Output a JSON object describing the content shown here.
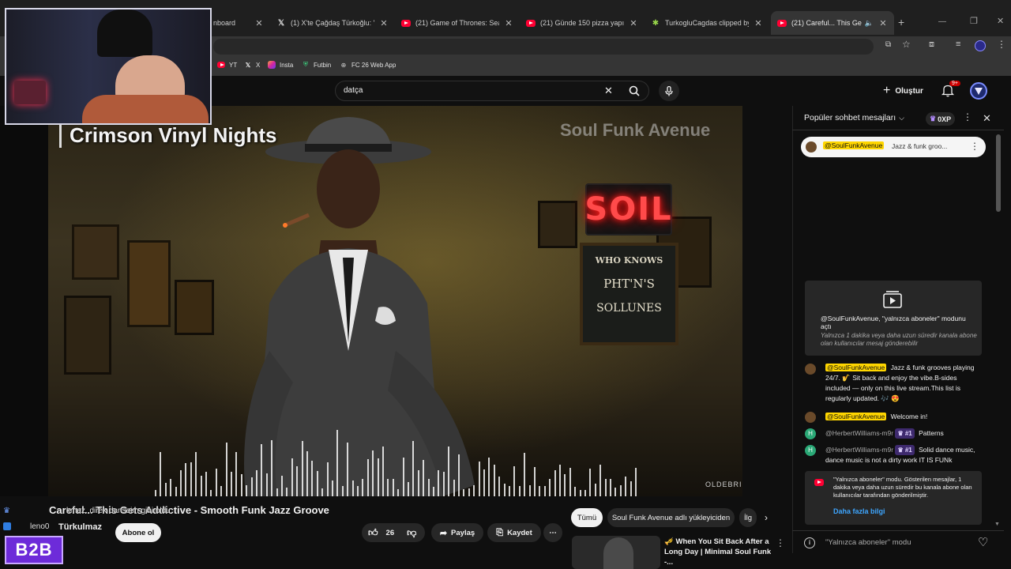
{
  "tabs": [
    {
      "label": "nboard",
      "icon": "dashboard-icon"
    },
    {
      "label": "(1) X'te Çağdaş Türkoğlu: \"Şim",
      "icon": "x-logo-icon"
    },
    {
      "label": "(21) Game of Thrones: Season",
      "icon": "youtube-icon"
    },
    {
      "label": "(21) Günde 150 pizza yapıp dü",
      "icon": "youtube-icon"
    },
    {
      "label": "TurkogluCagdas clipped by Tur",
      "icon": "twitch-clip-icon"
    },
    {
      "label": "(21) Careful... This Gets Add",
      "icon": "youtube-icon"
    }
  ],
  "bookmarks": [
    {
      "label": "YT",
      "icon": "youtube-icon"
    },
    {
      "label": "X",
      "icon": "x-logo-icon"
    },
    {
      "label": "Insta",
      "icon": "instagram-icon"
    },
    {
      "label": "Futbin",
      "icon": "futbin-icon"
    },
    {
      "label": "FC 26 Web App",
      "icon": "globe-icon"
    }
  ],
  "search": {
    "value": "datça"
  },
  "header": {
    "create_label": "Oluştur",
    "notif_count": "9+"
  },
  "video": {
    "overlay_title": "Crimson Vinyl Nights",
    "watermark": "Soul Funk Avenue",
    "neon_sign": "SOIL",
    "board_text": [
      "WHO KNOWS",
      "PHT'N'S",
      "SOLLUNES"
    ],
    "corner_mark": "OLDEBRI"
  },
  "below": {
    "video_title": "Careful... This Gets Addictive - Smooth Funk Jazz Groove",
    "overlay_text": "kmez. direk danseim gibi oldu",
    "channel_overlay": "Türkulmaz",
    "user_overlay": "leno0",
    "subscribe_label": "Abone ol",
    "like_count": "26",
    "share_label": "Paylaş",
    "save_label": "Kaydet",
    "filters": [
      "Tümü",
      "Soul Funk Avenue adlı yükleyiciden",
      "İlg"
    ],
    "rec_title_1": "When You Sit Back After a",
    "rec_title_2": "Long Day | Minimal Soul Funk -..."
  },
  "chat": {
    "header": "Popüler sohbet mesajları",
    "xp": "0XP",
    "pinned_author": "@SoulFunkAvenue",
    "pinned_text": "Jazz & funk groo...",
    "members_title": "@SoulFunkAvenue, \"yalnızca aboneler\" modunu açtı",
    "members_sub": "Yalnızca 1 dakika veya daha uzun süredir kanala abone olan kullanıcılar mesaj gönderebilir",
    "messages": [
      {
        "author": "@SoulFunkAvenue",
        "text": "Jazz & funk grooves playing 24/7. 🎷 Sit back and enjoy the vibe.B-sides included — only on this live stream.This list is regularly updated. 🎶 😍"
      },
      {
        "author": "@SoulFunkAvenue",
        "text": "Welcome in!"
      },
      {
        "author": "@HerbertWilliams-m9r",
        "badge": "#1",
        "text": "Patterns"
      },
      {
        "author": "@HerbertWilliams-m9r",
        "badge": "#1",
        "text": "Solid dance music, dance music is not a dirty work IT IS FUNk"
      }
    ],
    "notice_text": "\"Yalnızca aboneler\" modu. Gösterilen mesajlar, 1 dakika veya daha uzun süredir bu kanala abone olan kullanıcılar tarafından gönderilmiştir.",
    "notice_link": "Daha fazla bilgi",
    "input_placeholder": "\"Yalnızca aboneler\" modu"
  },
  "stream_overlay": {
    "logo": "B2B"
  }
}
